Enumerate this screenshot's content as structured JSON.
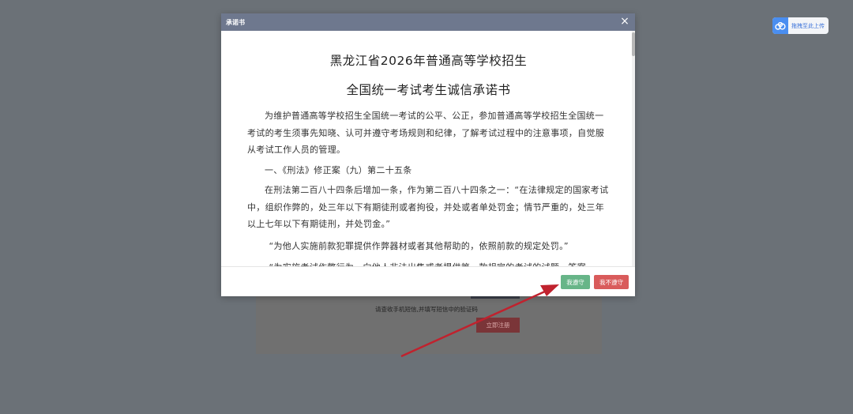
{
  "modal": {
    "title": "承诺书",
    "close_glyph": "×"
  },
  "document": {
    "title": "黑龙江省2026年普通高等学校招生",
    "subtitle": "全国统一考试考生诚信承诺书",
    "paragraphs": [
      "为维护普通高等学校招生全国统一考试的公平、公正，参加普通高等学校招生全国统一考试的考生须事先知晓、认可并遵守考场规则和纪律，了解考试过程中的注意事项，自觉服从考试工作人员的管理。",
      "一、《刑法》修正案（九）第二十五条",
      "在刑法第二百八十四条后增加一条，作为第二百八十四条之一：“在法律规定的国家考试中，组织作弊的，处三年以下有期徒刑或者拘役，并处或者单处罚金；情节严重的，处三年以上七年以下有期徒刑，并处罚金。”",
      "“为他人实施前款犯罪提供作弊器材或者其他帮助的，依照前款的规定处罚。”",
      "“为实施考试作弊行为，向他人非法出售或者提供第一款规定的考试的试题、答案"
    ]
  },
  "buttons": {
    "agree": "我遵守",
    "disagree": "我不遵守"
  },
  "background_page": {
    "hint": "请查收手机短信,并填写短信中的验证码",
    "register_button": "立即注册"
  },
  "upload_badge": {
    "label": "拖拽至此上传",
    "icon": "cloud-upload-icon"
  },
  "colors": {
    "overlay": "#6b7177",
    "header": "#6e788e",
    "agree": "#67b588",
    "disagree": "#d95b5b",
    "arrow": "#c0222e"
  }
}
